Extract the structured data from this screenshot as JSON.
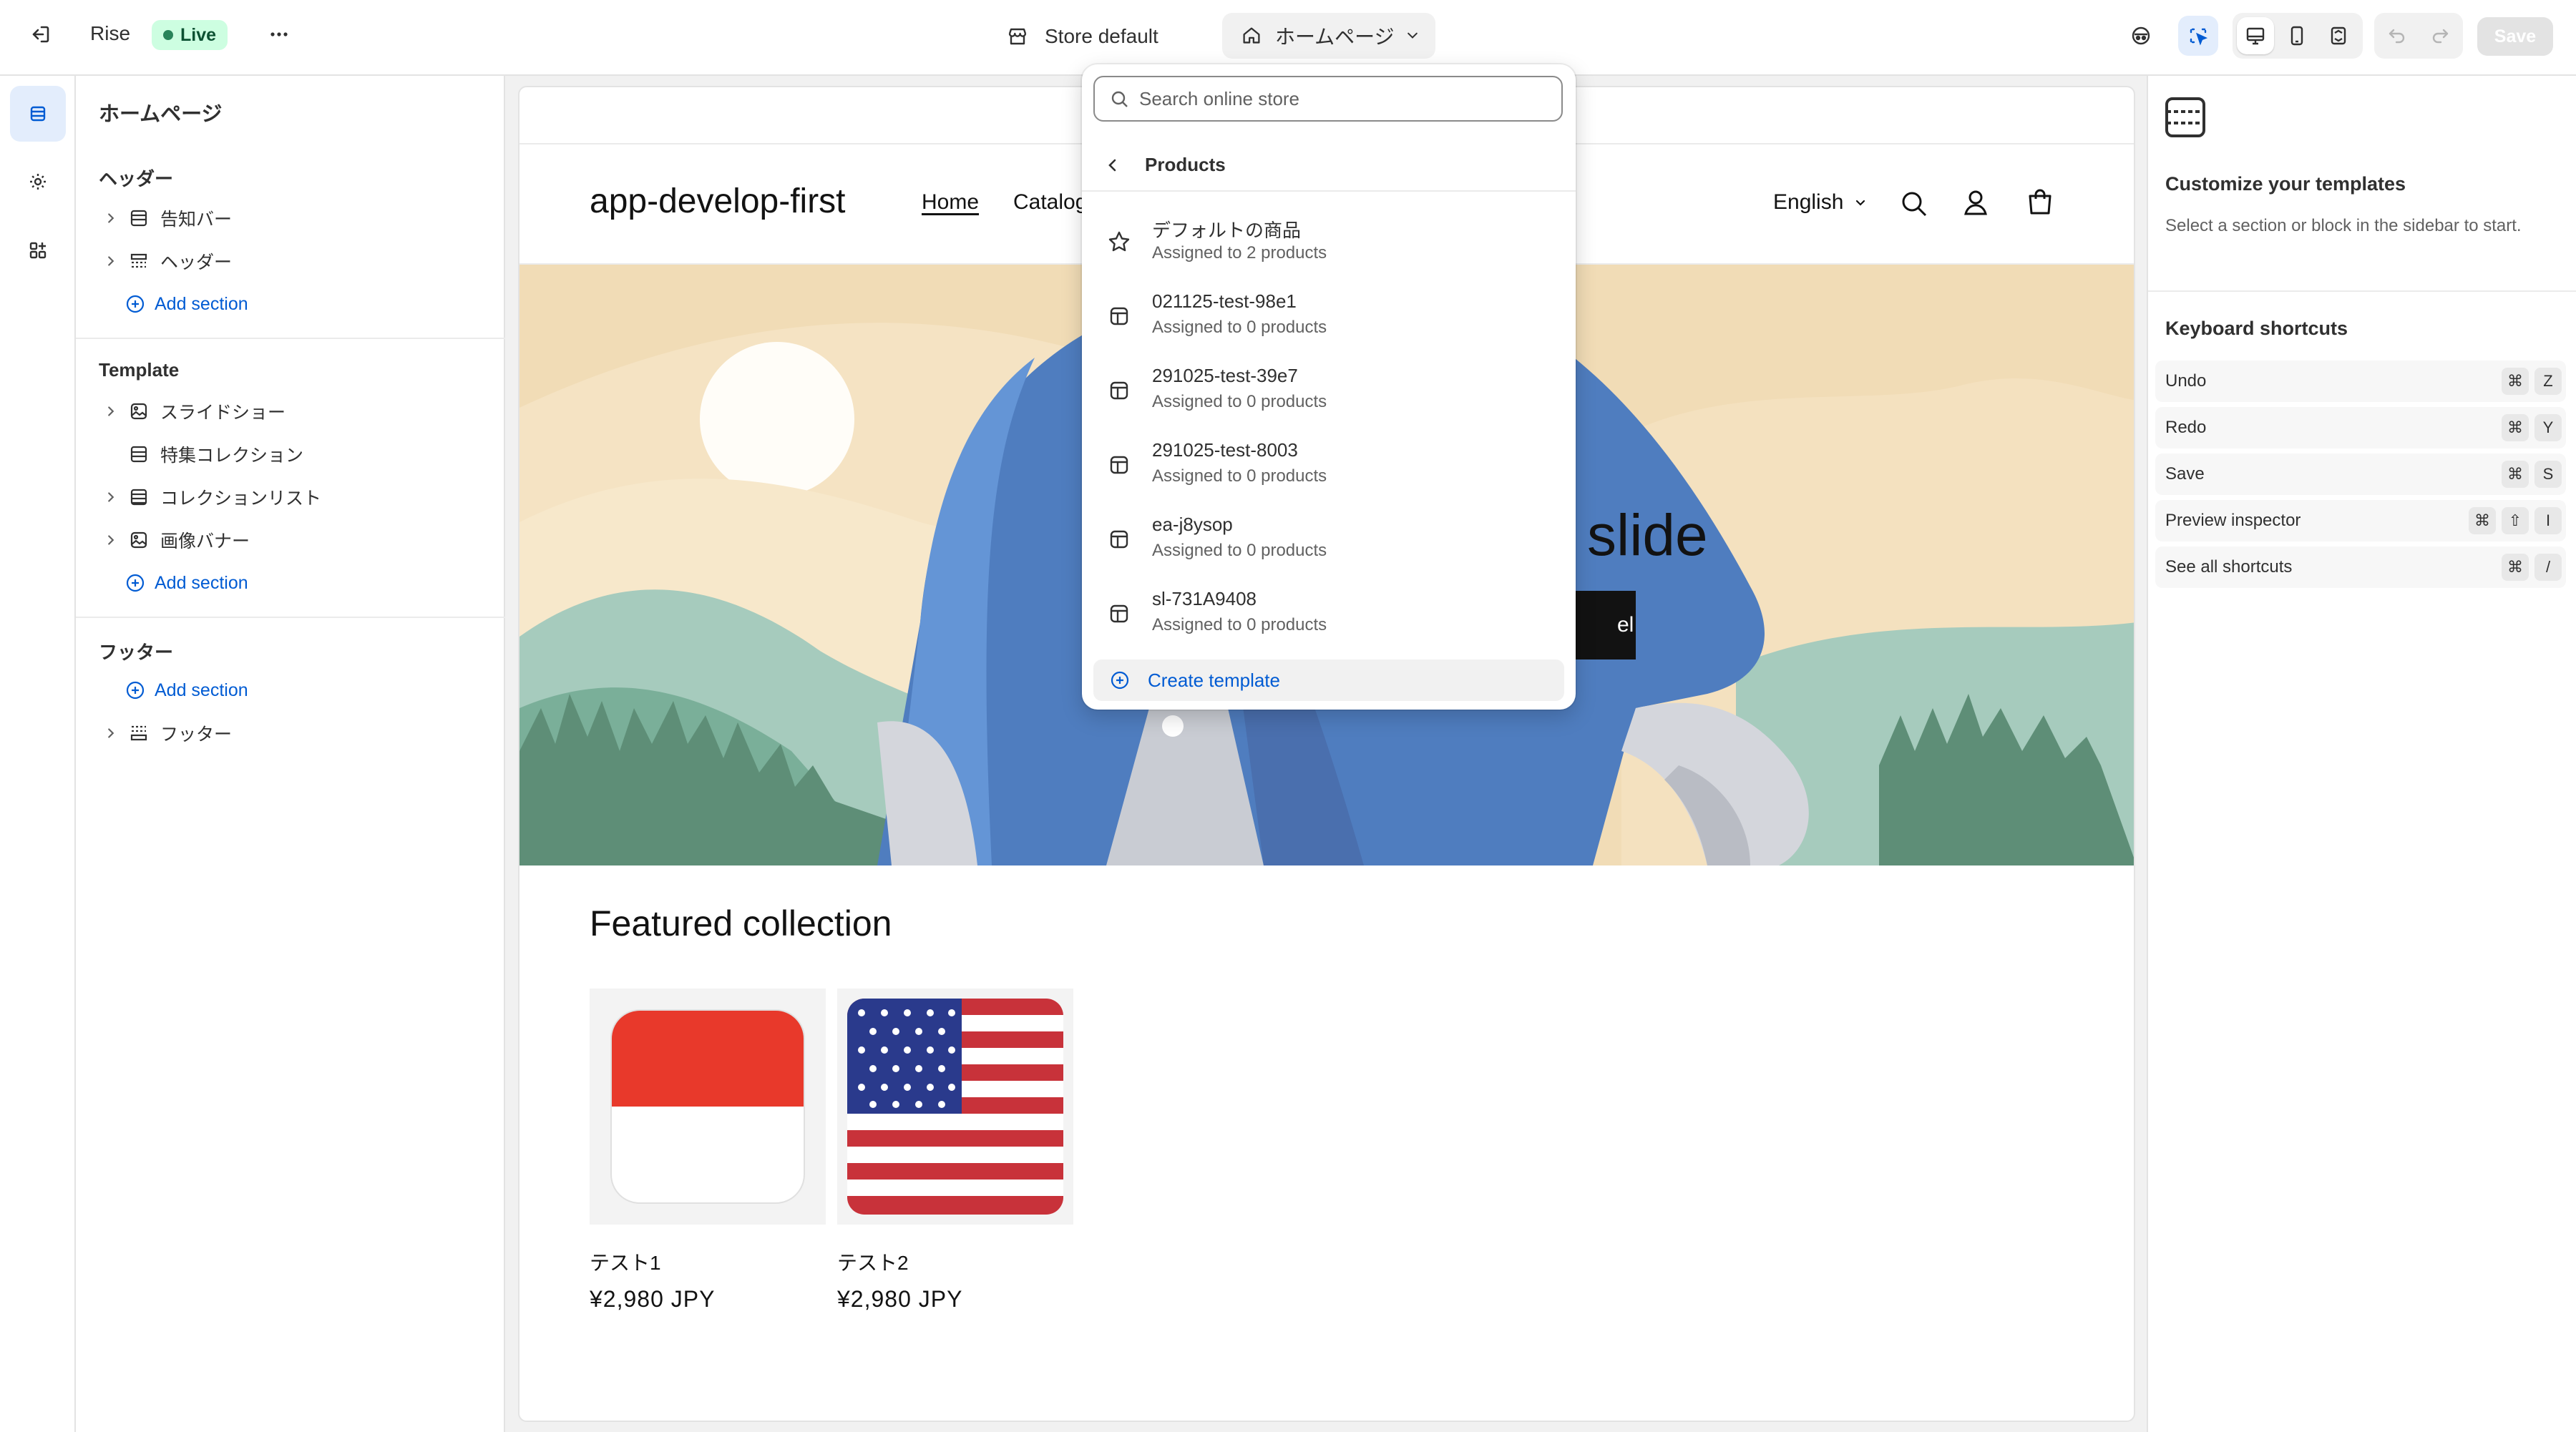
{
  "topbar": {
    "app_name": "Rise",
    "status": "Live",
    "store_theme": "Store default",
    "current_page": "ホームページ",
    "save_label": "Save"
  },
  "sidebar": {
    "title": "ホームページ",
    "groups": [
      {
        "label": "ヘッダー",
        "items": [
          "告知バー",
          "ヘッダー"
        ],
        "add": "Add section"
      },
      {
        "label": "Template",
        "items": [
          "スライドショー",
          "特集コレクション",
          "コレクションリスト",
          "画像バナー"
        ],
        "add": "Add section"
      },
      {
        "label": "フッター",
        "items": [
          "フッター"
        ],
        "add": "Add section"
      }
    ]
  },
  "preview": {
    "store_name": "app-develop-first",
    "nav": [
      "Home",
      "Catalog"
    ],
    "language": "English",
    "hero_heading_partial": "slide",
    "hero_button_partial": "el",
    "featured_title": "Featured collection",
    "products": [
      {
        "name": "テスト1",
        "price": "¥2,980 JPY"
      },
      {
        "name": "テスト2",
        "price": "¥2,980 JPY"
      }
    ]
  },
  "dropdown": {
    "search_placeholder": "Search online store",
    "back_label": "Products",
    "templates": [
      {
        "name": "デフォルトの商品",
        "assigned": "Assigned to 2 products",
        "icon": "star-icon"
      },
      {
        "name": "021125-test-98e1",
        "assigned": "Assigned to 0 products",
        "icon": "template-icon"
      },
      {
        "name": "291025-test-39e7",
        "assigned": "Assigned to 0 products",
        "icon": "template-icon"
      },
      {
        "name": "291025-test-8003",
        "assigned": "Assigned to 0 products",
        "icon": "template-icon"
      },
      {
        "name": "ea-j8ysop",
        "assigned": "Assigned to 0 products",
        "icon": "template-icon"
      },
      {
        "name": "sl-731A9408",
        "assigned": "Assigned to 0 products",
        "icon": "template-icon"
      }
    ],
    "create_label": "Create template"
  },
  "right_panel": {
    "title": "Customize your templates",
    "description": "Select a section or block in the sidebar to start.",
    "shortcuts_title": "Keyboard shortcuts",
    "shortcuts": [
      {
        "label": "Undo",
        "keys": [
          "⌘",
          "Z"
        ]
      },
      {
        "label": "Redo",
        "keys": [
          "⌘",
          "Y"
        ]
      },
      {
        "label": "Save",
        "keys": [
          "⌘",
          "S"
        ]
      },
      {
        "label": "Preview inspector",
        "keys": [
          "⌘",
          "⇧",
          "I"
        ]
      },
      {
        "label": "See all shortcuts",
        "keys": [
          "⌘",
          "/"
        ]
      }
    ]
  },
  "colors": {
    "accent": "#005bd3",
    "live_bg": "#cdfee1",
    "live_text": "#0c5132"
  }
}
